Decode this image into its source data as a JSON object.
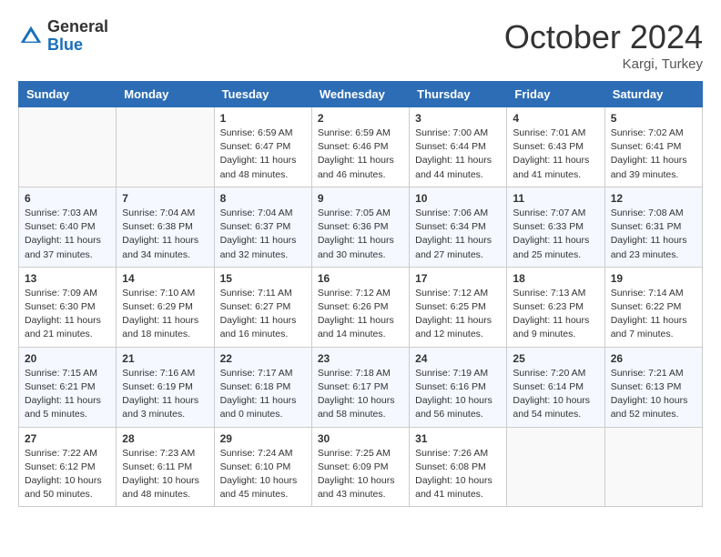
{
  "header": {
    "logo_general": "General",
    "logo_blue": "Blue",
    "month_title": "October 2024",
    "location": "Kargi, Turkey"
  },
  "columns": [
    "Sunday",
    "Monday",
    "Tuesday",
    "Wednesday",
    "Thursday",
    "Friday",
    "Saturday"
  ],
  "weeks": [
    [
      {
        "day": "",
        "info": ""
      },
      {
        "day": "",
        "info": ""
      },
      {
        "day": "1",
        "info": "Sunrise: 6:59 AM\nSunset: 6:47 PM\nDaylight: 11 hours and 48 minutes."
      },
      {
        "day": "2",
        "info": "Sunrise: 6:59 AM\nSunset: 6:46 PM\nDaylight: 11 hours and 46 minutes."
      },
      {
        "day": "3",
        "info": "Sunrise: 7:00 AM\nSunset: 6:44 PM\nDaylight: 11 hours and 44 minutes."
      },
      {
        "day": "4",
        "info": "Sunrise: 7:01 AM\nSunset: 6:43 PM\nDaylight: 11 hours and 41 minutes."
      },
      {
        "day": "5",
        "info": "Sunrise: 7:02 AM\nSunset: 6:41 PM\nDaylight: 11 hours and 39 minutes."
      }
    ],
    [
      {
        "day": "6",
        "info": "Sunrise: 7:03 AM\nSunset: 6:40 PM\nDaylight: 11 hours and 37 minutes."
      },
      {
        "day": "7",
        "info": "Sunrise: 7:04 AM\nSunset: 6:38 PM\nDaylight: 11 hours and 34 minutes."
      },
      {
        "day": "8",
        "info": "Sunrise: 7:04 AM\nSunset: 6:37 PM\nDaylight: 11 hours and 32 minutes."
      },
      {
        "day": "9",
        "info": "Sunrise: 7:05 AM\nSunset: 6:36 PM\nDaylight: 11 hours and 30 minutes."
      },
      {
        "day": "10",
        "info": "Sunrise: 7:06 AM\nSunset: 6:34 PM\nDaylight: 11 hours and 27 minutes."
      },
      {
        "day": "11",
        "info": "Sunrise: 7:07 AM\nSunset: 6:33 PM\nDaylight: 11 hours and 25 minutes."
      },
      {
        "day": "12",
        "info": "Sunrise: 7:08 AM\nSunset: 6:31 PM\nDaylight: 11 hours and 23 minutes."
      }
    ],
    [
      {
        "day": "13",
        "info": "Sunrise: 7:09 AM\nSunset: 6:30 PM\nDaylight: 11 hours and 21 minutes."
      },
      {
        "day": "14",
        "info": "Sunrise: 7:10 AM\nSunset: 6:29 PM\nDaylight: 11 hours and 18 minutes."
      },
      {
        "day": "15",
        "info": "Sunrise: 7:11 AM\nSunset: 6:27 PM\nDaylight: 11 hours and 16 minutes."
      },
      {
        "day": "16",
        "info": "Sunrise: 7:12 AM\nSunset: 6:26 PM\nDaylight: 11 hours and 14 minutes."
      },
      {
        "day": "17",
        "info": "Sunrise: 7:12 AM\nSunset: 6:25 PM\nDaylight: 11 hours and 12 minutes."
      },
      {
        "day": "18",
        "info": "Sunrise: 7:13 AM\nSunset: 6:23 PM\nDaylight: 11 hours and 9 minutes."
      },
      {
        "day": "19",
        "info": "Sunrise: 7:14 AM\nSunset: 6:22 PM\nDaylight: 11 hours and 7 minutes."
      }
    ],
    [
      {
        "day": "20",
        "info": "Sunrise: 7:15 AM\nSunset: 6:21 PM\nDaylight: 11 hours and 5 minutes."
      },
      {
        "day": "21",
        "info": "Sunrise: 7:16 AM\nSunset: 6:19 PM\nDaylight: 11 hours and 3 minutes."
      },
      {
        "day": "22",
        "info": "Sunrise: 7:17 AM\nSunset: 6:18 PM\nDaylight: 11 hours and 0 minutes."
      },
      {
        "day": "23",
        "info": "Sunrise: 7:18 AM\nSunset: 6:17 PM\nDaylight: 10 hours and 58 minutes."
      },
      {
        "day": "24",
        "info": "Sunrise: 7:19 AM\nSunset: 6:16 PM\nDaylight: 10 hours and 56 minutes."
      },
      {
        "day": "25",
        "info": "Sunrise: 7:20 AM\nSunset: 6:14 PM\nDaylight: 10 hours and 54 minutes."
      },
      {
        "day": "26",
        "info": "Sunrise: 7:21 AM\nSunset: 6:13 PM\nDaylight: 10 hours and 52 minutes."
      }
    ],
    [
      {
        "day": "27",
        "info": "Sunrise: 7:22 AM\nSunset: 6:12 PM\nDaylight: 10 hours and 50 minutes."
      },
      {
        "day": "28",
        "info": "Sunrise: 7:23 AM\nSunset: 6:11 PM\nDaylight: 10 hours and 48 minutes."
      },
      {
        "day": "29",
        "info": "Sunrise: 7:24 AM\nSunset: 6:10 PM\nDaylight: 10 hours and 45 minutes."
      },
      {
        "day": "30",
        "info": "Sunrise: 7:25 AM\nSunset: 6:09 PM\nDaylight: 10 hours and 43 minutes."
      },
      {
        "day": "31",
        "info": "Sunrise: 7:26 AM\nSunset: 6:08 PM\nDaylight: 10 hours and 41 minutes."
      },
      {
        "day": "",
        "info": ""
      },
      {
        "day": "",
        "info": ""
      }
    ]
  ]
}
